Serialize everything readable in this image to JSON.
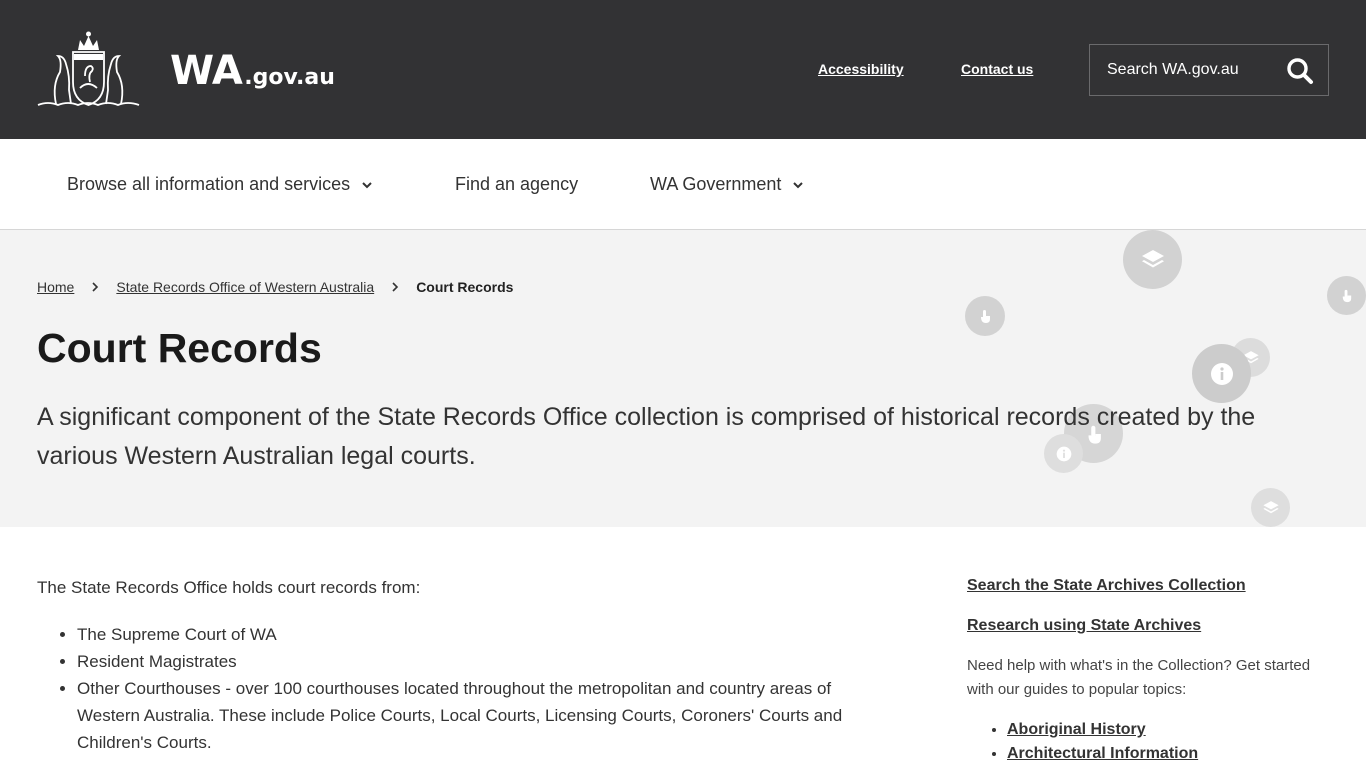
{
  "header": {
    "logo_text": "WA",
    "logo_domain": ".gov.au",
    "links": {
      "accessibility": "Accessibility",
      "contact": "Contact us"
    },
    "search": {
      "placeholder": "Search WA.gov.au",
      "icon": "search-icon"
    },
    "background": "#323234"
  },
  "nav": {
    "items": [
      {
        "label": "Browse all information and services",
        "icon": "chevron-down-icon"
      },
      {
        "label": "Find an agency"
      },
      {
        "label": "WA Government",
        "icon": "chevron-down-icon"
      }
    ]
  },
  "breadcrumb": {
    "items": [
      "Home",
      "State Records Office of Western Australia"
    ],
    "current": "Court Records"
  },
  "hero": {
    "title": "Court Records",
    "intro": "A significant component of the State Records Office collection is comprised of historical records created by the various Western Australian legal courts.",
    "background": "#f3f3f3",
    "decor_icons": [
      "layers-icon",
      "touch-icon",
      "info-icon"
    ]
  },
  "main": {
    "lead": "The State Records Office holds court records from:",
    "list": [
      "The Supreme Court of WA",
      "Resident Magistrates",
      "Other Courthouses - over 100 courthouses located throughout the metropolitan and country areas of Western Australia. These include Police Courts, Local Courts, Licensing Courts, Coroners' Courts and Children's Courts."
    ]
  },
  "aside": {
    "links": [
      "Search the State Archives Collection",
      "Research using State Archives"
    ],
    "help_text": "Need help with what's in the Collection? Get started with our guides to popular topics:",
    "topics": [
      "Aboriginal History",
      "Architectural Information"
    ]
  }
}
